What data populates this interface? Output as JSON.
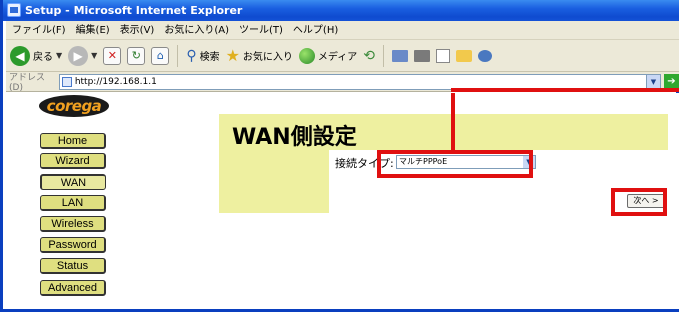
{
  "window": {
    "title": "Setup - Microsoft Internet Explorer"
  },
  "menu": {
    "items": [
      "ファイル(F)",
      "編集(E)",
      "表示(V)",
      "お気に入り(A)",
      "ツール(T)",
      "ヘルプ(H)"
    ]
  },
  "toolbar": {
    "back_label": "戻る",
    "search_label": "検索",
    "favorites_label": "お気に入り",
    "media_label": "メディア"
  },
  "address": {
    "label": "アドレス(D)",
    "url": "http://192.168.1.1"
  },
  "logo": {
    "text": "corega"
  },
  "nav": {
    "items": [
      {
        "label": "Home"
      },
      {
        "label": "Wizard"
      },
      {
        "label": "WAN"
      },
      {
        "label": "LAN"
      },
      {
        "label": "Wireless"
      },
      {
        "label": "Password"
      },
      {
        "label": "Status"
      },
      {
        "label": "Advanced"
      }
    ]
  },
  "main": {
    "title": "WAN側設定",
    "connection_type_label": "接続タイプ:",
    "connection_type_value": "マルチPPPoE",
    "next_label": "次へ >"
  },
  "colors": {
    "panel": "#eef0a0",
    "nav_button": "#dfdf80",
    "highlight": "#e01010",
    "titlebar": "#0f4bd0"
  }
}
